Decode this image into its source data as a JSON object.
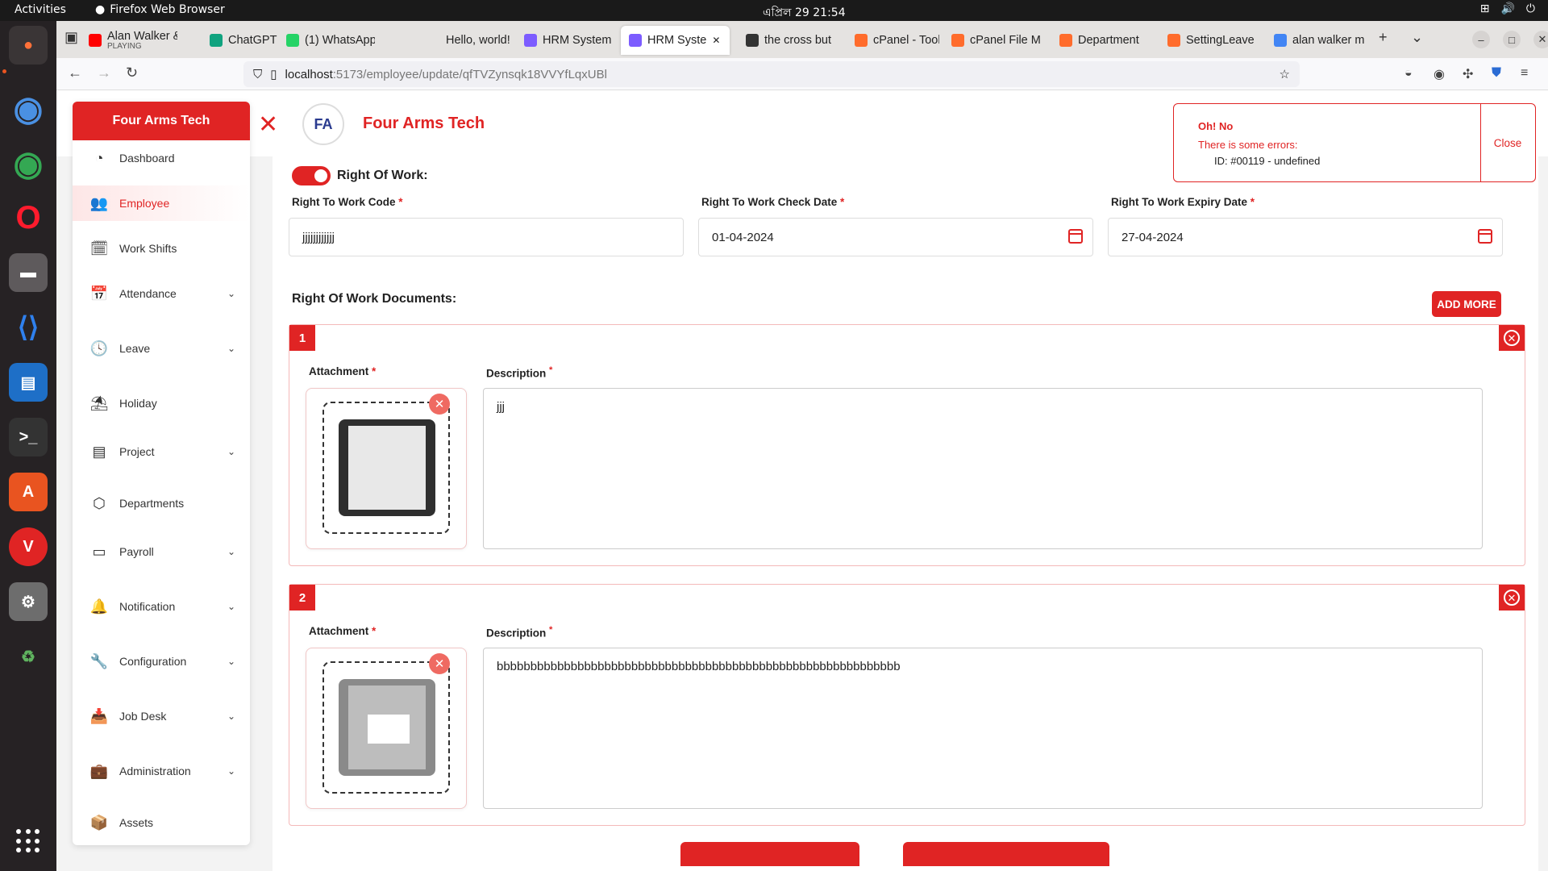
{
  "os": {
    "activities": "Activities",
    "app_name": "Firefox Web Browser",
    "clock": "এপ্রিল 29  21:54"
  },
  "tabs": [
    {
      "label": "Alan Walker &",
      "sub": "PLAYING",
      "icon": "youtube-icon",
      "color": "#ff0000"
    },
    {
      "label": "ChatGPT",
      "icon": "chatgpt-icon",
      "color": "#10a37f"
    },
    {
      "label": "(1) WhatsApp",
      "icon": "whatsapp-icon",
      "color": "#25d366"
    },
    {
      "label": "Hello, world!",
      "icon": "blank-icon",
      "color": "#e5e3e1"
    },
    {
      "label": "HRM System",
      "icon": "vite-icon",
      "color": "#7c5cff"
    },
    {
      "label": "HRM Syste",
      "icon": "vite-icon",
      "color": "#7c5cff"
    },
    {
      "label": "the cross but",
      "icon": "page-icon",
      "color": "#333"
    },
    {
      "label": "cPanel - Tools",
      "icon": "cpanel-icon",
      "color": "#ff6c2c"
    },
    {
      "label": "cPanel File M",
      "icon": "cpanel-icon",
      "color": "#ff6c2c"
    },
    {
      "label": "Department",
      "icon": "cpanel-icon",
      "color": "#ff6c2c"
    },
    {
      "label": "SettingLeave",
      "icon": "cpanel-icon",
      "color": "#ff6c2c"
    },
    {
      "label": "alan walker m",
      "icon": "google-icon",
      "color": "#4285f4"
    }
  ],
  "url": {
    "host": "localhost",
    "path": ":5173/employee/update/qfTVZynsqk18VVYfLqxUBl"
  },
  "brand": {
    "sidebar_title": "Four Arms Tech",
    "header_title": "Four Arms Tech",
    "logo_text": "FA"
  },
  "sidebar": [
    {
      "label": "Dashboard",
      "icon": "pie-chart-icon",
      "glyph": "◔",
      "expand": false
    },
    {
      "label": "Employee",
      "icon": "users-icon",
      "glyph": "👥",
      "expand": false,
      "active": true
    },
    {
      "label": "Work Shifts",
      "icon": "calendar-clock-icon",
      "glyph": "🗓",
      "expand": false
    },
    {
      "label": "Attendance",
      "icon": "calendar-icon",
      "glyph": "📅",
      "expand": true
    },
    {
      "label": "Leave",
      "icon": "clock-icon",
      "glyph": "🕓",
      "expand": true
    },
    {
      "label": "Holiday",
      "icon": "beach-icon",
      "glyph": "⛱",
      "expand": false
    },
    {
      "label": "Project",
      "icon": "document-icon",
      "glyph": "▤",
      "expand": true
    },
    {
      "label": "Departments",
      "icon": "cubes-icon",
      "glyph": "⬡",
      "expand": false
    },
    {
      "label": "Payroll",
      "icon": "credit-card-icon",
      "glyph": "▭",
      "expand": true
    },
    {
      "label": "Notification",
      "icon": "bell-icon",
      "glyph": "🔔",
      "expand": true
    },
    {
      "label": "Configuration",
      "icon": "wrench-icon",
      "glyph": "🔧",
      "expand": true
    },
    {
      "label": "Job Desk",
      "icon": "inbox-icon",
      "glyph": "📥",
      "expand": true
    },
    {
      "label": "Administration",
      "icon": "briefcase-icon",
      "glyph": "💼",
      "expand": true
    },
    {
      "label": "Assets",
      "icon": "box-icon",
      "glyph": "📦",
      "expand": false
    }
  ],
  "form": {
    "toggle_label": "Right Of Work:",
    "code_label": "Right To Work Code",
    "code_value": "jjjjjjjjjjjj",
    "check_label": "Right To Work Check Date",
    "check_value": "01-04-2024",
    "expiry_label": "Right To Work Expiry Date",
    "expiry_value": "27-04-2024",
    "required_mark": "*",
    "docs_title": "Right Of Work Documents:",
    "add_more": "ADD MORE",
    "attachment_label": "Attachment",
    "description_label": "Description",
    "documents": [
      {
        "number": "1",
        "description": "jjj"
      },
      {
        "number": "2",
        "description": "bbbbbbbbbbbbbbbbbbbbbbbbbbbbbbbbbbbbbbbbbbbbbbbbbbbbbbbbbbbb"
      }
    ]
  },
  "toast": {
    "title": "Oh! No",
    "subtitle": "There is some errors:",
    "message": "ID: #00119 - undefined",
    "close": "Close"
  },
  "colors": {
    "accent": "#e02424",
    "toast_border": "#e02424"
  }
}
